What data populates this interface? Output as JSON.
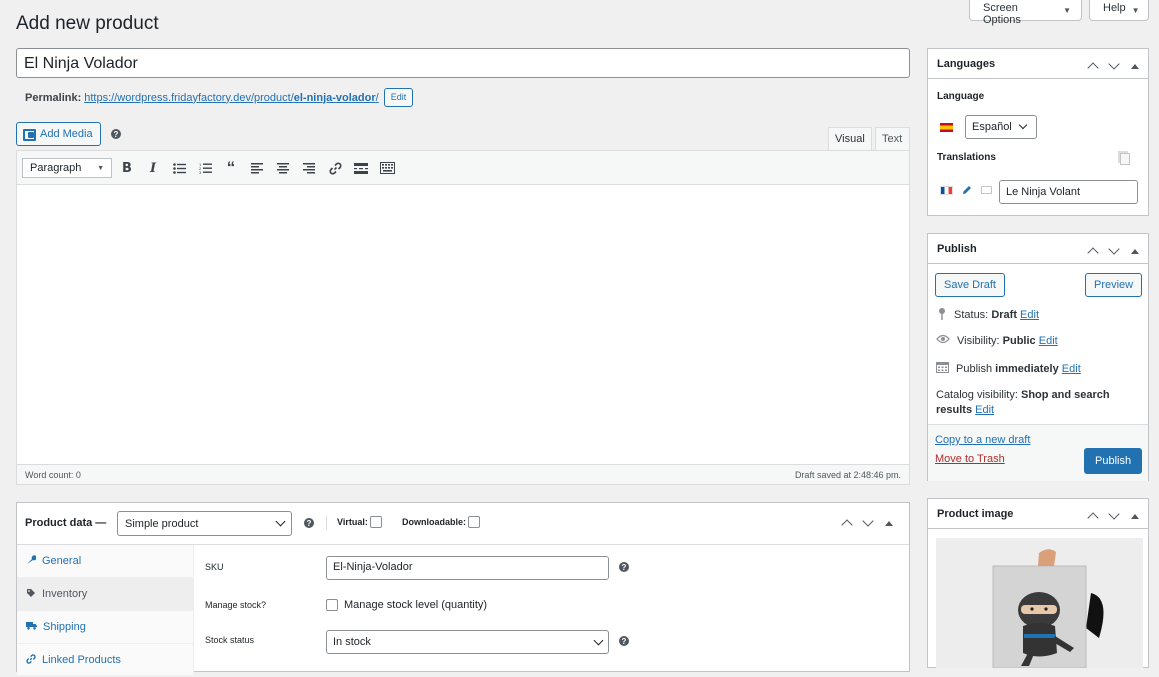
{
  "page": {
    "title": "Add new product"
  },
  "topbar": {
    "screen_options": "Screen Options",
    "help": "Help"
  },
  "product": {
    "title": "El Ninja Volador",
    "permalink_label": "Permalink:",
    "permalink_base": "https://wordpress.fridayfactory.dev/product/",
    "permalink_slug": "el-ninja-volador",
    "permalink_end": "/",
    "edit_label": "Edit"
  },
  "editor": {
    "add_media": "Add Media",
    "tab_visual": "Visual",
    "tab_text": "Text",
    "format_value": "Paragraph",
    "word_count": "Word count: 0",
    "draft_saved": "Draft saved at 2:48:46 pm.",
    "icons": [
      "bold-icon",
      "italic-icon",
      "bullet-list-icon",
      "numbered-list-icon",
      "blockquote-icon",
      "align-left-icon",
      "align-center-icon",
      "align-right-icon",
      "link-icon",
      "read-more-icon",
      "toolbar-toggle-icon"
    ]
  },
  "product_data": {
    "title": "Product data —",
    "type": "Simple product",
    "virtual_label": "Virtual:",
    "downloadable_label": "Downloadable:",
    "tabs": [
      {
        "label": "General",
        "icon": "wrench-icon"
      },
      {
        "label": "Inventory",
        "icon": "tag-icon"
      },
      {
        "label": "Shipping",
        "icon": "truck-icon"
      },
      {
        "label": "Linked Products",
        "icon": "link-icon"
      }
    ],
    "sku_label": "SKU",
    "sku_value": "El-Ninja-Volador",
    "manage_stock_label": "Manage stock?",
    "manage_stock_desc": "Manage stock level (quantity)",
    "stock_status_label": "Stock status",
    "stock_status_value": "In stock"
  },
  "languages": {
    "title": "Languages",
    "language_label": "Language",
    "language_value": "Español",
    "translations_label": "Translations",
    "translation_fr_value": "Le Ninja Volant"
  },
  "publish": {
    "title": "Publish",
    "save_draft": "Save Draft",
    "preview": "Preview",
    "status_label": "Status:",
    "status_value": "Draft",
    "visibility_label": "Visibility:",
    "visibility_value": "Public",
    "publish_label": "Publish",
    "publish_value": "immediately",
    "catalog_label": "Catalog visibility:",
    "catalog_value_1": "Shop and search",
    "catalog_value_2": "results",
    "edit": "Edit",
    "copy_draft": "Copy to a new draft",
    "trash": "Move to Trash",
    "publish_button": "Publish"
  },
  "product_image": {
    "title": "Product image"
  },
  "colors": {
    "accent": "#2271b1",
    "trash": "#b32d2e",
    "bg": "#f0f0f1"
  }
}
